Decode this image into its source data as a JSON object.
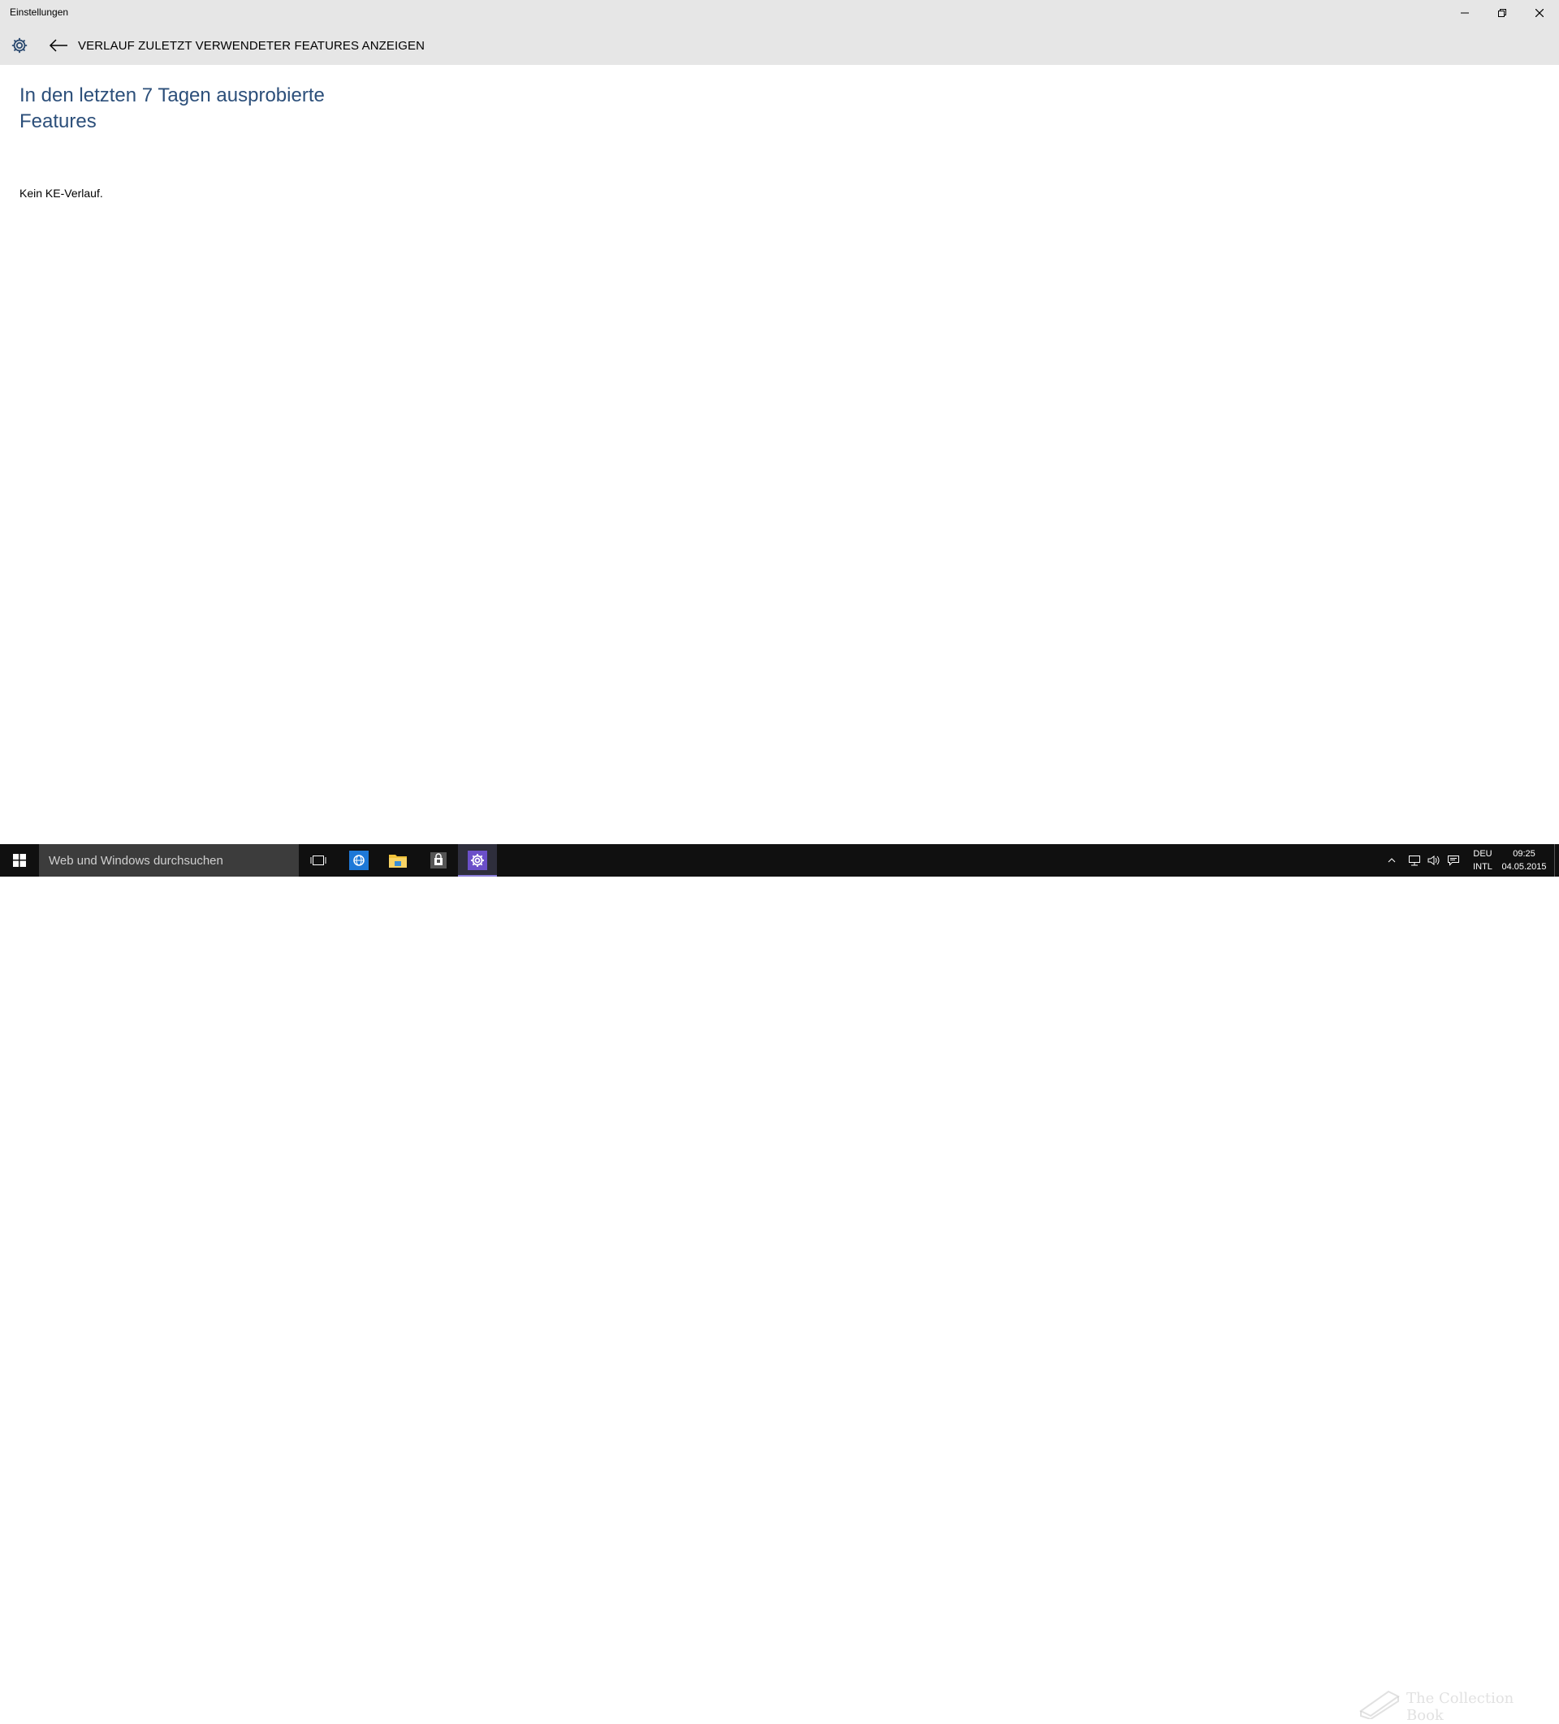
{
  "window": {
    "title": "Einstellungen"
  },
  "header": {
    "page_title": "VERLAUF ZULETZT VERWENDETER FEATURES ANZEIGEN",
    "home_icon": "gear-icon",
    "back_icon": "arrow-left-icon"
  },
  "content": {
    "heading": "In den letzten 7 Tagen ausprobierte Features",
    "status": "Kein KE-Verlauf."
  },
  "taskbar": {
    "search_placeholder": "Web und Windows durchsuchen",
    "apps": [
      "task-view-icon",
      "internet-explorer-icon",
      "file-explorer-icon",
      "store-icon",
      "settings-icon"
    ],
    "active_app": "settings-icon",
    "watermark_text": "The Collection Book",
    "language_line1": "DEU",
    "language_line2": "INTL",
    "time": "09:25",
    "date": "04.05.2015"
  },
  "colors": {
    "title_bar": "#e6e6e6",
    "heading_text": "#2c4f7a",
    "taskbar": "#101010",
    "accent": "#8a7dd8"
  }
}
